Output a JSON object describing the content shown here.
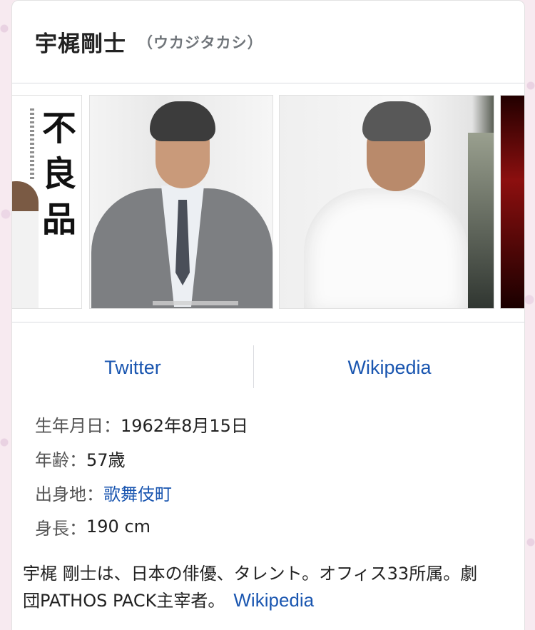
{
  "header": {
    "name": "宇梶剛士",
    "reading": "（ウカジタカシ）"
  },
  "images": {
    "poster_title": "不良品"
  },
  "links": {
    "twitter_label": "Twitter",
    "wikipedia_label": "Wikipedia"
  },
  "facts": [
    {
      "label": "生年月日：",
      "value": "1962年8月15日"
    },
    {
      "label": "年齢：",
      "value": "57歳"
    },
    {
      "label": "出身地：",
      "value": "歌舞伎町"
    },
    {
      "label": "身長：",
      "value": "190 cm"
    }
  ],
  "description": {
    "text": "宇梶 剛士は、日本の俳優、タレント。オフィス33所属。劇団PATHOS PACK主宰者。",
    "source_link": "Wikipedia"
  },
  "colors": {
    "link": "#1a56b0",
    "text": "#222222",
    "muted": "#70757a"
  }
}
